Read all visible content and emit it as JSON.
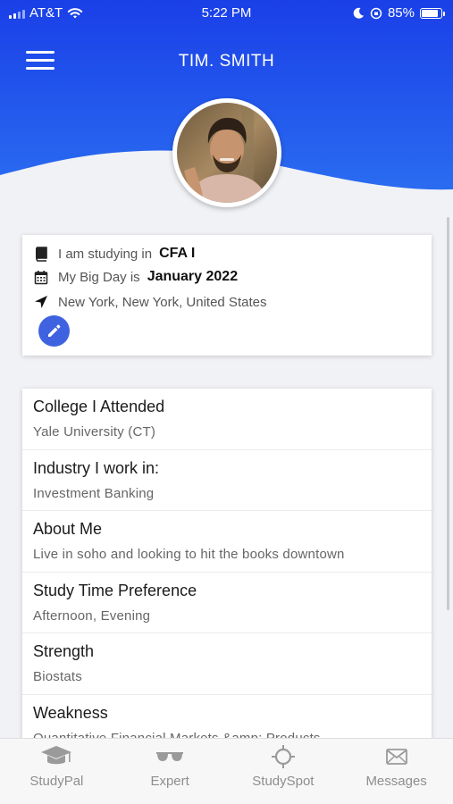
{
  "status_bar": {
    "carrier": "AT&T",
    "time": "5:22 PM",
    "battery_percent": "85%",
    "battery_level": 0.85
  },
  "header": {
    "title": "TIM. SMITH",
    "menu_icon": "hamburger-menu-icon",
    "gradient_colors": [
      "#1a3fe8",
      "#2a6cf0"
    ]
  },
  "info": {
    "studying_prefix": "I am studying in",
    "studying_value": "CFA I",
    "bigday_prefix": "My Big Day is",
    "bigday_value": "January 2022",
    "location": "New York, New York, United States",
    "edit_icon": "pencil-icon"
  },
  "details": [
    {
      "heading": "College I Attended",
      "value": "Yale University (CT)"
    },
    {
      "heading": "Industry I work in:",
      "value": "Investment Banking"
    },
    {
      "heading": "About Me",
      "value": "Live in soho and looking to hit the books downtown"
    },
    {
      "heading": "Study Time Preference",
      "value": "Afternoon, Evening"
    },
    {
      "heading": "Strength",
      "value": "Biostats"
    },
    {
      "heading": "Weakness",
      "value": "Quantitative,Financial Markets &amp; Products"
    }
  ],
  "tabs": [
    {
      "label": "StudyPal",
      "icon": "graduation-cap-icon"
    },
    {
      "label": "Expert",
      "icon": "glasses-icon"
    },
    {
      "label": "StudySpot",
      "icon": "crosshair-icon"
    },
    {
      "label": "Messages",
      "icon": "envelope-icon"
    }
  ],
  "colors": {
    "accent": "#3f63e0",
    "background": "#f1f2f6",
    "tab_inactive": "#8e8e8e"
  }
}
